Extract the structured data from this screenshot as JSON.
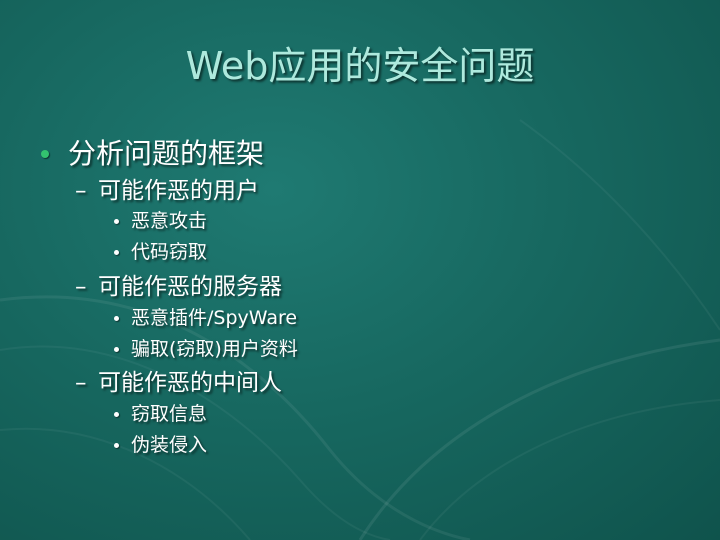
{
  "slide": {
    "title": "Web应用的安全问题",
    "bullets": [
      {
        "text": "分析问题的框架",
        "subs": [
          {
            "text": "可能作恶的用户",
            "items": [
              "恶意攻击",
              "代码窃取"
            ]
          },
          {
            "text": "可能作恶的服务器",
            "items": [
              "恶意插件/SpyWare",
              "骗取(窃取)用户资料"
            ]
          },
          {
            "text": "可能作恶的中间人",
            "items": [
              "窃取信息",
              "伪装侵入"
            ]
          }
        ]
      }
    ],
    "colors": {
      "background": "#176860",
      "title": "#aee9dd",
      "bullet_level1": "#33c36f",
      "text": "#ffffff"
    }
  }
}
